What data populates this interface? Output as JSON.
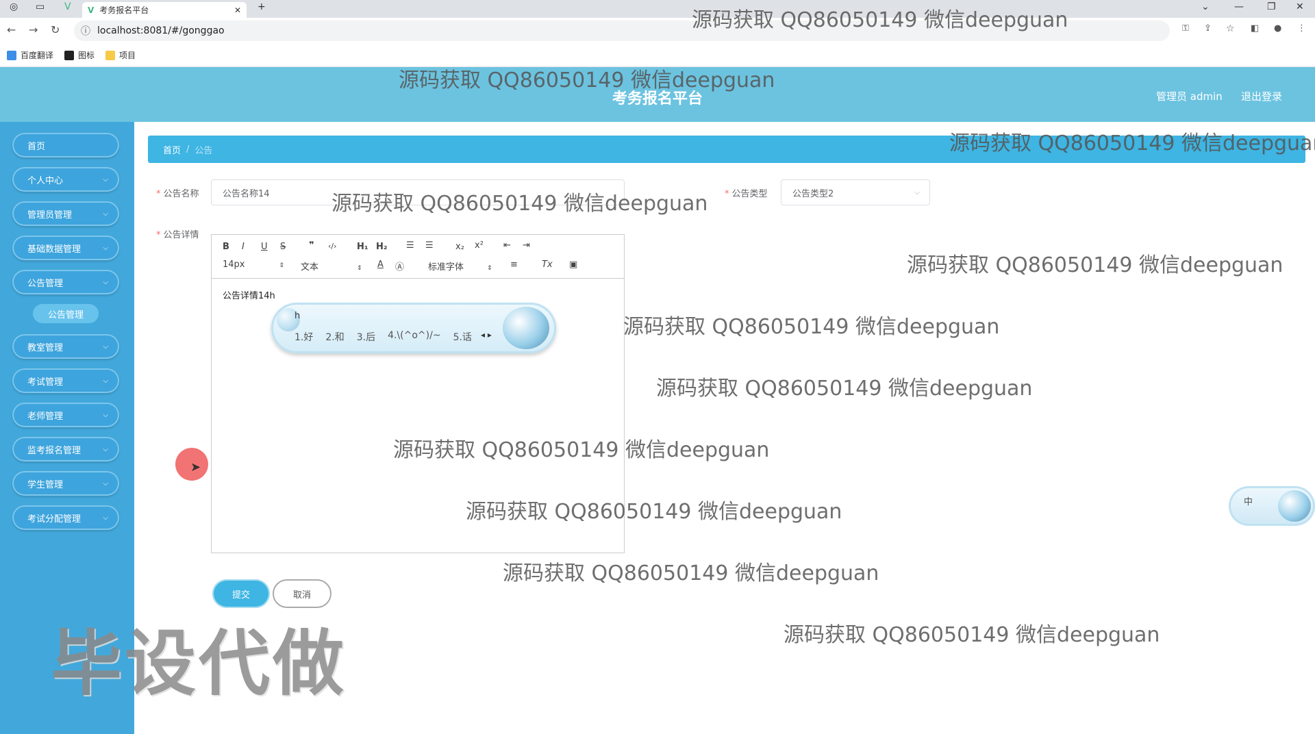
{
  "browser": {
    "tab_title": "考务报名平台",
    "url": "localhost:8081/#/gonggao",
    "bookmarks": [
      "百度翻译",
      "图标",
      "项目"
    ]
  },
  "header": {
    "title": "考务报名平台",
    "admin": "管理员 admin",
    "logout": "退出登录",
    "color": "#6cc3e0"
  },
  "sidebar": {
    "color": "#42a8db",
    "items": [
      {
        "label": "首页",
        "chevron": false
      },
      {
        "label": "个人中心",
        "chevron": true
      },
      {
        "label": "管理员管理",
        "chevron": true
      },
      {
        "label": "基础数据管理",
        "chevron": true
      },
      {
        "label": "公告管理",
        "chevron": true
      },
      {
        "label": "教室管理",
        "chevron": true
      },
      {
        "label": "考试管理",
        "chevron": true
      },
      {
        "label": "老师管理",
        "chevron": true
      },
      {
        "label": "监考报名管理",
        "chevron": true
      },
      {
        "label": "学生管理",
        "chevron": true
      },
      {
        "label": "考试分配管理",
        "chevron": true
      }
    ],
    "sub_item": "公告管理"
  },
  "breadcrumb": {
    "home": "首页",
    "sep": "/",
    "current": "公告"
  },
  "form": {
    "name_label": "公告名称",
    "name_value": "公告名称14",
    "type_label": "公告类型",
    "type_value": "公告类型2",
    "detail_label": "公告详情",
    "editor": {
      "font_size": "14px",
      "header": "文本",
      "font": "标准字体",
      "content": "公告详情14h"
    },
    "submit": "提交",
    "cancel": "取消"
  },
  "ime": {
    "input": "h",
    "candidates": [
      "1.好",
      "2.和",
      "3.后",
      "4.\\(^o^)/~",
      "5.话"
    ],
    "mode": "中"
  },
  "watermarks": [
    "源码获取 QQ86050149 微信deepguan",
    "源码获取 QQ86050149 微信deepguan",
    "源码获取 QQ86050149 微信deepguan",
    "源码获取 QQ86050149 微信deepguan",
    "源码获取 QQ86050149 微信deepguan",
    "源码获取 QQ86050149 微信deepguan",
    "源码获取 QQ86050149 微信deepguan",
    "源码获取 QQ86050149 微信deepguan",
    "源码获取 QQ86050149 微信deepguan",
    "源码获取 QQ86050149 微信deepguan",
    "源码获取 QQ86050149 微信deepguan"
  ],
  "big_watermark": "毕设代做"
}
